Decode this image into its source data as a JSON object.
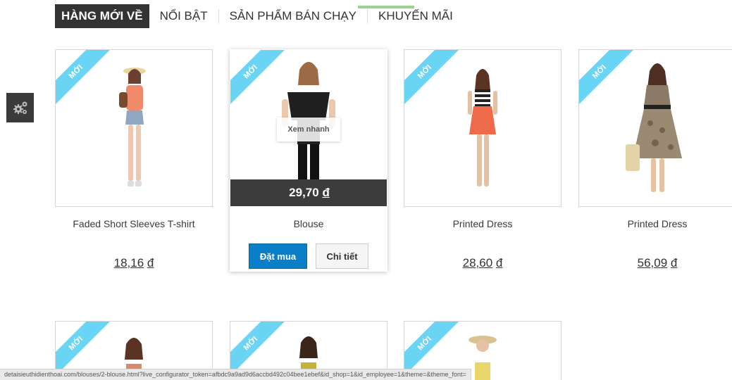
{
  "tabs": [
    {
      "label": "HÀNG MỚI VỀ",
      "active": true
    },
    {
      "label": "NỔI BẬT",
      "active": false
    },
    {
      "label": "SẢN PHẨM BÁN CHẠY",
      "active": false
    },
    {
      "label": "KHUYẾN MÃI",
      "active": false
    }
  ],
  "new_badge": "Mới",
  "quick_view_label": "Xem nhanh",
  "buy_label": "Đặt mua",
  "detail_label": "Chi tiết",
  "currency": "đ",
  "products": [
    {
      "name": "Faded Short Sleeves T-shirt",
      "price": "18,16",
      "currency": "đ"
    },
    {
      "name": "Blouse",
      "price": "29,70",
      "currency": "đ"
    },
    {
      "name": "Printed Dress",
      "price": "28,60",
      "currency": "đ"
    },
    {
      "name": "Printed Dress",
      "price": "56,09",
      "currency": "đ"
    }
  ],
  "status_url": "detaisieuthidienthoai.com/blouses/2-blouse.html?live_configurator_token=afbdc9a9ad9d6accbd492c04bee1ebef&id_shop=1&id_employee=1&theme=&theme_font=",
  "colors": {
    "accent_blue": "#0b7ec8",
    "ribbon": "#6ad4f5",
    "tab_active": "#333333"
  }
}
